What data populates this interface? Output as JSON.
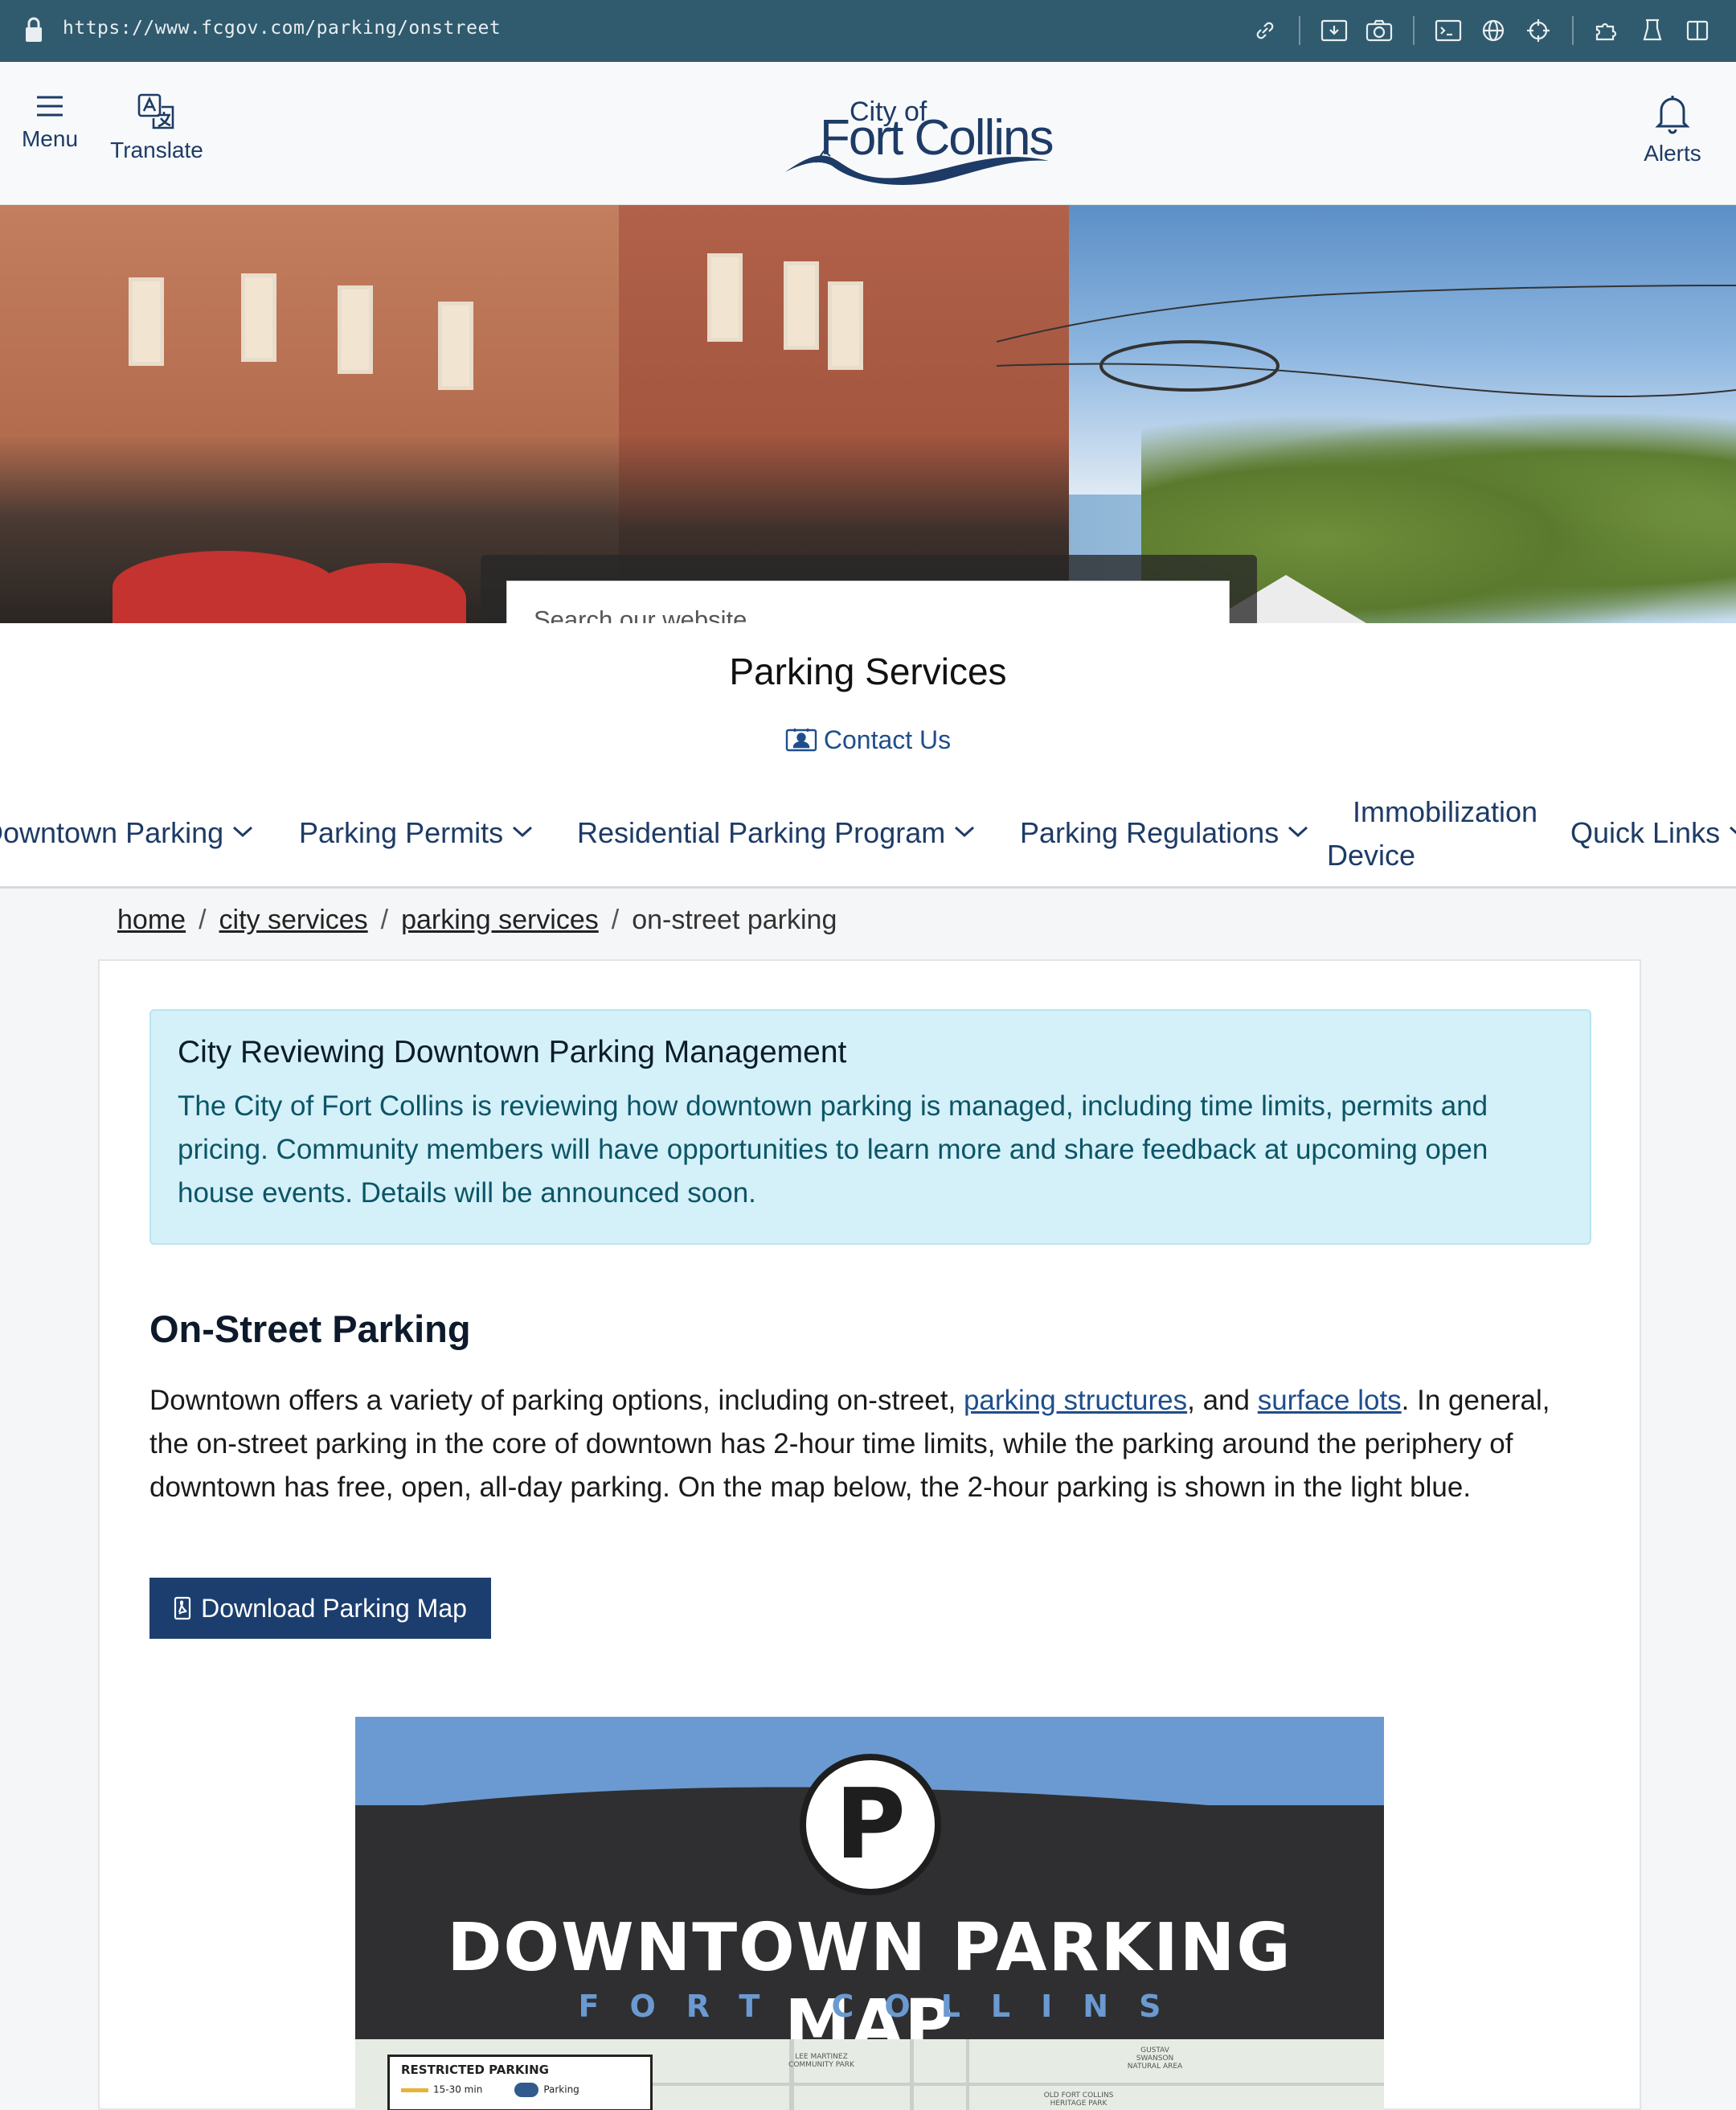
{
  "browser": {
    "url": "https://www.fcgov.com/parking/onstreet",
    "toolbar_icons": [
      "link-icon",
      "image-download-icon",
      "camera-icon",
      "terminal-icon",
      "globe-icon",
      "crosshair-icon",
      "puzzle-icon",
      "flask-icon",
      "sidebar-icon"
    ]
  },
  "header": {
    "menu_label": "Menu",
    "translate_label": "Translate",
    "alerts_label": "Alerts",
    "logo_line1": "City of",
    "logo_line2": "Fort Collins"
  },
  "hero": {
    "search_placeholder": "Search our website"
  },
  "department": {
    "title": "Parking Services",
    "contact_label": "Contact Us"
  },
  "nav": {
    "items": [
      {
        "label": "Downtown Parking"
      },
      {
        "label": "Parking Permits"
      },
      {
        "label": "Residential Parking Program"
      },
      {
        "label": "Parking Regulations"
      },
      {
        "label_line1": "Immobilization",
        "label_line2": "Device"
      },
      {
        "label": "Quick Links"
      }
    ]
  },
  "breadcrumb": {
    "items": [
      "home",
      "city services",
      "parking services"
    ],
    "current": "on-street parking"
  },
  "alert": {
    "title": "City Reviewing Downtown Parking Management",
    "body": "The City of Fort Collins is reviewing how downtown parking is managed, including time limits, permits and pricing. Community members will have opportunities to learn more and share feedback at upcoming open house events. Details will be announced soon."
  },
  "section": {
    "heading": "On-Street Parking",
    "p_part1": "Downtown offers a variety of parking options, including on-street, ",
    "link1": "parking structures",
    "p_part2": ", and ",
    "link2": "surface lots",
    "p_part3": ". In general, the on-street parking in the core of downtown has 2-hour time limits, while the parking around the periphery of downtown has free, open, all-day parking. On the map below, the 2-hour parking is shown in the light blue.",
    "download_label": "Download Parking Map"
  },
  "map_image": {
    "title": "DOWNTOWN PARKING MAP",
    "subtitle": "FORT COLLINS",
    "p_letter": "P",
    "legend_title": "RESTRICTED PARKING",
    "legend_item1": "15-30 min",
    "legend_item2": "Parking",
    "label_park1": "LEE MARTINEZ COMMUNITY PARK",
    "label_park2": "GUSTAV SWANSON NATURAL AREA",
    "label_park3": "OLD FORT COLLINS HERITAGE PARK"
  }
}
